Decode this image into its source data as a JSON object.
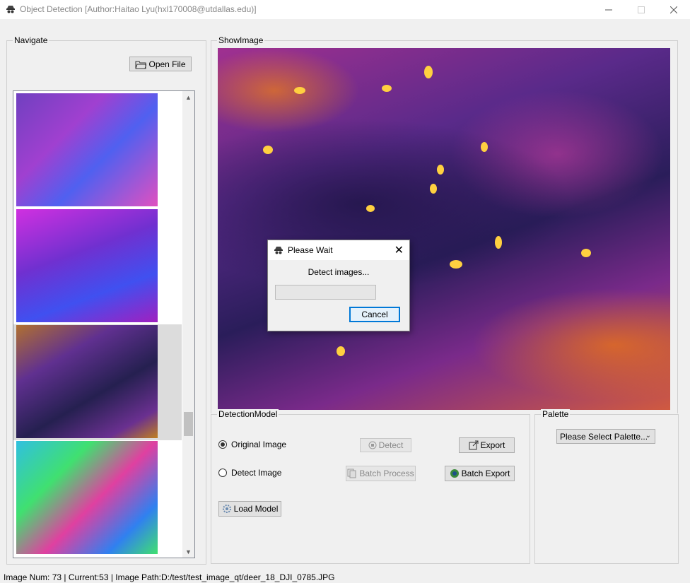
{
  "window": {
    "title": "Object Detection [Author:Haitao Lyu(hxl170008@utdallas.edu)]",
    "minimize_icon": "minimize-icon",
    "maximize_icon": "maximize-icon",
    "close_icon": "close-icon"
  },
  "navigate": {
    "group_label": "Navigate",
    "open_file_label": "Open File",
    "thumbnails": [
      {
        "colors": [
          "#a040d0",
          "#5060f0",
          "#e050c0"
        ]
      },
      {
        "colors": [
          "#d030e0",
          "#4050f0",
          "#a020c0"
        ]
      },
      {
        "colors": [
          "#603090",
          "#252050",
          "#c08020"
        ],
        "selected": true
      },
      {
        "colors": [
          "#30c0e0",
          "#e040a0",
          "#40e070"
        ]
      }
    ]
  },
  "show_image": {
    "group_label": "ShowImage"
  },
  "detection_model": {
    "group_label": "DetectionModel",
    "original_image_label": "Original Image",
    "original_image_checked": true,
    "detect_image_label": "Detect Image",
    "detect_image_checked": false,
    "detect_label": "Detect",
    "export_label": "Export",
    "batch_process_label": "Batch Process",
    "batch_export_label": "Batch Export",
    "load_model_label": "Load Model"
  },
  "palette": {
    "group_label": "Palette",
    "selected": "Please Select Palette..."
  },
  "dialog": {
    "title": "Please Wait",
    "message": "Detect images...",
    "progress": 0,
    "cancel_label": "Cancel"
  },
  "status_bar": {
    "text": "Image Num: 73 | Current:53 | Image Path:D:/test/test_image_qt/deer_18_DJI_0785.JPG"
  }
}
